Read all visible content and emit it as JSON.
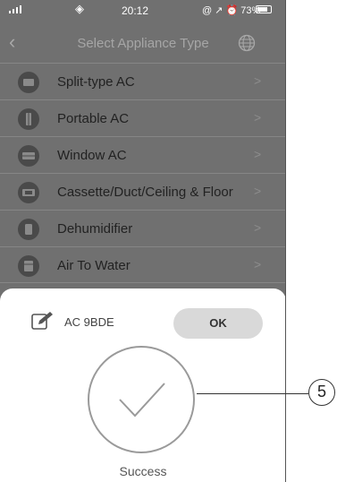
{
  "status_bar": {
    "time": "20:12",
    "right_indicators": "@ ↗ ⏰ 73%",
    "battery_percent": 73
  },
  "nav": {
    "title": "Select Appliance Type"
  },
  "appliance_list": [
    {
      "label": "Split-type AC",
      "icon": "split-ac-icon"
    },
    {
      "label": "Portable AC",
      "icon": "portable-ac-icon"
    },
    {
      "label": "Window AC",
      "icon": "window-ac-icon"
    },
    {
      "label": "Cassette/Duct/Ceiling & Floor",
      "icon": "cassette-icon"
    },
    {
      "label": "Dehumidifier",
      "icon": "dehumidifier-icon"
    },
    {
      "label": "Air To Water",
      "icon": "air-to-water-icon"
    }
  ],
  "sheet": {
    "device_name": "AC 9BDE",
    "ok_label": "OK",
    "success_label": "Success"
  },
  "callout": {
    "number": "5"
  },
  "colors": {
    "overlay": "#707070",
    "sheet": "#ffffff",
    "ok_button": "#d9d9d9"
  }
}
